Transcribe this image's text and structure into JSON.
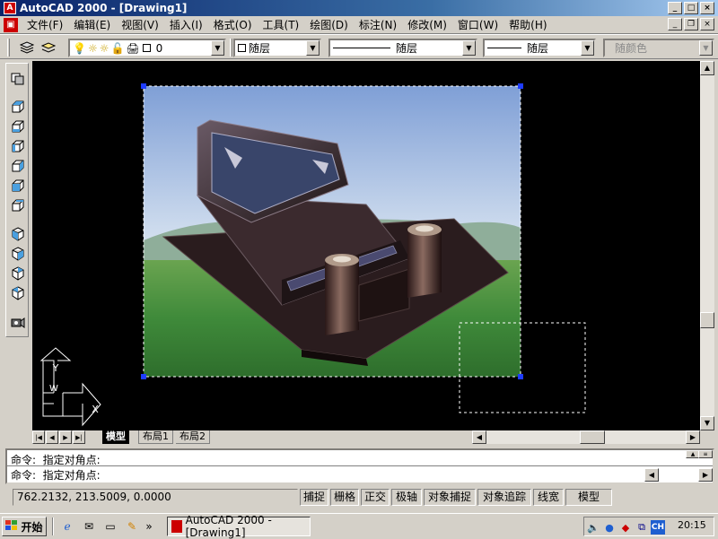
{
  "window": {
    "title": "AutoCAD 2000 - [Drawing1]",
    "app_icon_glyph": "A"
  },
  "menu": {
    "items": [
      "文件(F)",
      "编辑(E)",
      "视图(V)",
      "插入(I)",
      "格式(O)",
      "工具(T)",
      "绘图(D)",
      "标注(N)",
      "修改(M)",
      "窗口(W)",
      "帮助(H)"
    ]
  },
  "toolbar": {
    "layer_value": "0",
    "color_value": "随层",
    "linetype_value": "随层",
    "lineweight_value": "随层",
    "plotstyle_value": "随颜色"
  },
  "tabs": {
    "model": "模型",
    "layout1": "布局1",
    "layout2": "布局2"
  },
  "command": {
    "line1": "命令:  指定对角点:",
    "line2": "命令:  指定对角点:"
  },
  "status": {
    "coords": "762.2132,  213.5009,  0.0000",
    "buttons": [
      "捕捉",
      "栅格",
      "正交",
      "极轴",
      "对象捕捉",
      "对象追踪",
      "线宽",
      "模型"
    ]
  },
  "taskbar": {
    "start_label": "开始",
    "task_label": "AutoCAD 2000 - [Drawing1]",
    "ql_more": "»",
    "tray_ime": "CH",
    "clock": "20:15"
  },
  "ucs": {
    "y_label": "Y",
    "w_label": "W",
    "x_label": "X"
  },
  "colors": {
    "title_start": "#0a246a",
    "title_end": "#a6caf0",
    "canvas_bg": "#000000",
    "sky": "#9fb9de",
    "grass": "#3f8a3a",
    "stone": "#3a2a2a"
  }
}
